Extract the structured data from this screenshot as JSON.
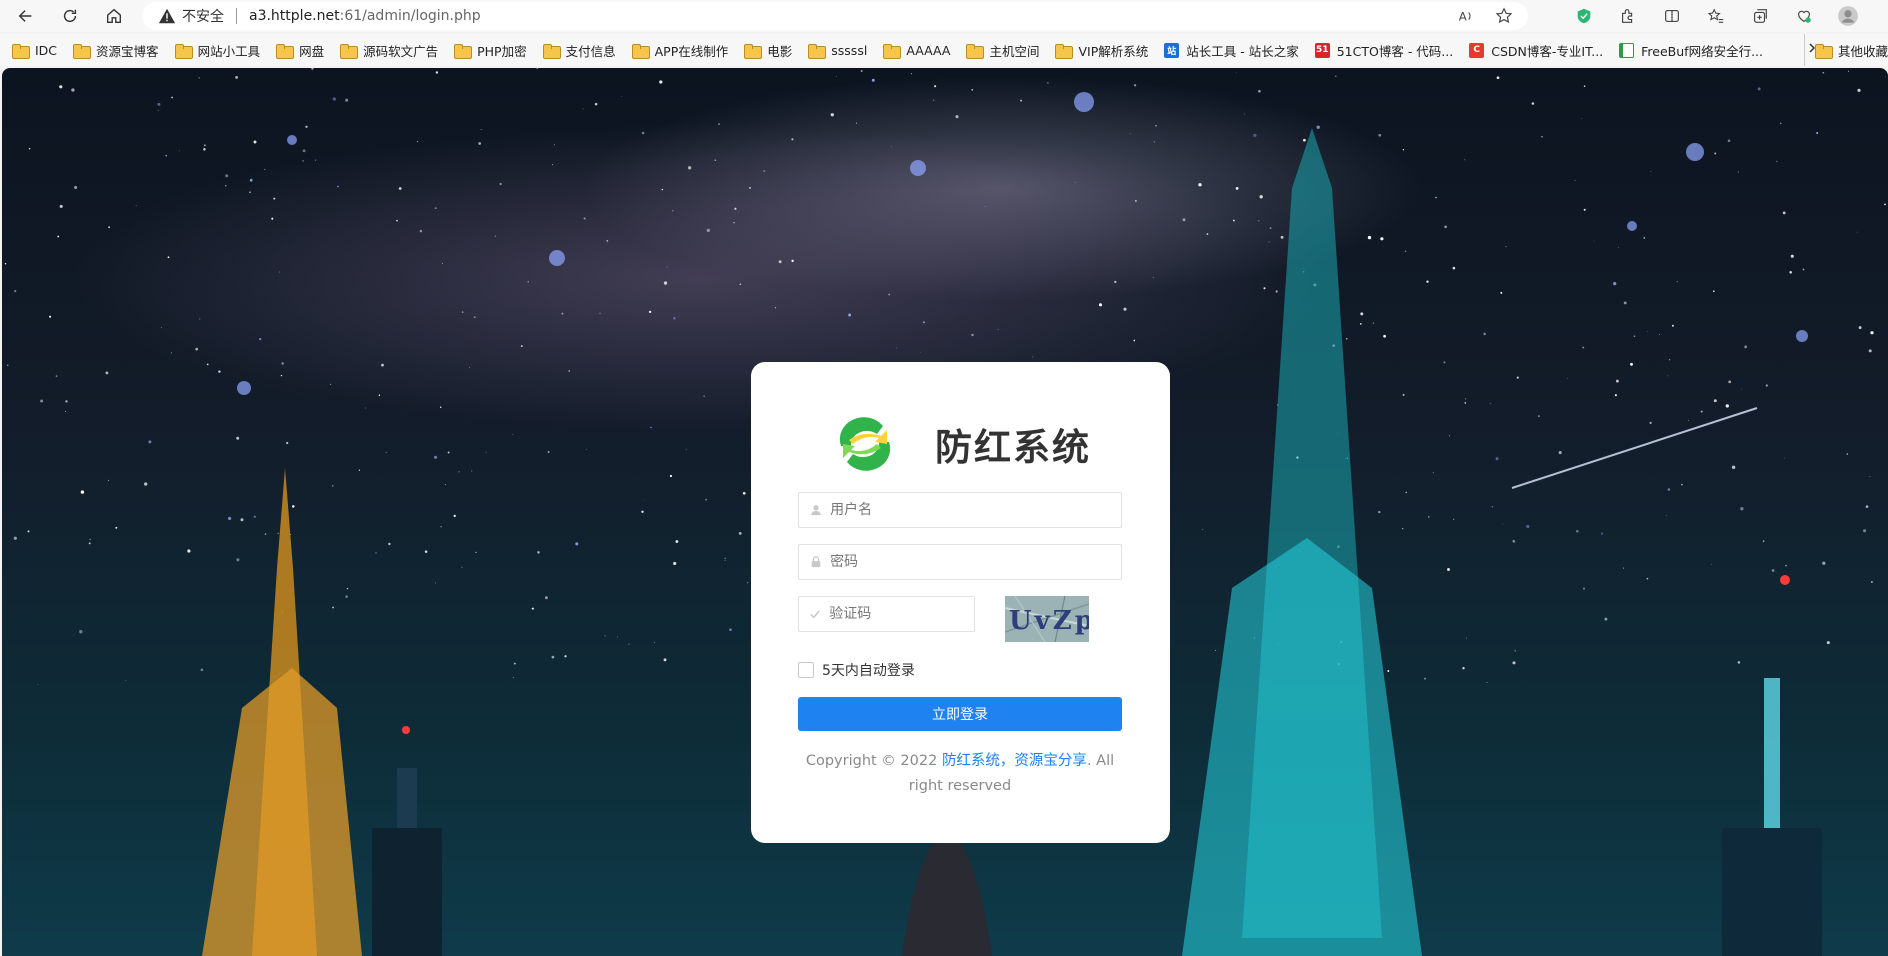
{
  "browser": {
    "insecure_label": "不安全",
    "url_host": "a3.httple.net",
    "url_rest": ":61/admin/login.php",
    "bookmarks": [
      {
        "label": "IDC",
        "icon": "folder"
      },
      {
        "label": "资源宝博客",
        "icon": "folder"
      },
      {
        "label": "网站小工具",
        "icon": "folder"
      },
      {
        "label": "网盘",
        "icon": "folder"
      },
      {
        "label": "源码软文广告",
        "icon": "folder"
      },
      {
        "label": "PHP加密",
        "icon": "folder"
      },
      {
        "label": "支付信息",
        "icon": "folder"
      },
      {
        "label": "APP在线制作",
        "icon": "folder"
      },
      {
        "label": "电影",
        "icon": "folder"
      },
      {
        "label": "sssssl",
        "icon": "folder"
      },
      {
        "label": "AAAAA",
        "icon": "folder"
      },
      {
        "label": "主机空间",
        "icon": "folder"
      },
      {
        "label": "VIP解析系统",
        "icon": "folder"
      },
      {
        "label": "站长工具 - 站长之家",
        "icon": "chinaz-favicon"
      },
      {
        "label": "51CTO博客 - 代码...",
        "icon": "51cto-favicon"
      },
      {
        "label": "CSDN博客-专业IT...",
        "icon": "csdn-favicon"
      },
      {
        "label": "FreeBuf网络安全行...",
        "icon": "freebuf-favicon"
      }
    ],
    "other_bookmarks": "其他收藏"
  },
  "login": {
    "brand": "防红系统",
    "username_placeholder": "用户名",
    "password_placeholder": "密码",
    "captcha_placeholder": "验证码",
    "captcha_text": "UvZp",
    "remember_label": "5天内自动登录",
    "submit_label": "立即登录",
    "copyright_prefix": "Copyright © 2022 ",
    "copyright_link": "防红系统，资源宝分享",
    "copyright_suffix": ". All right reserved"
  },
  "colors": {
    "primary": "#1e82f0",
    "folder": "#f5c64a"
  }
}
